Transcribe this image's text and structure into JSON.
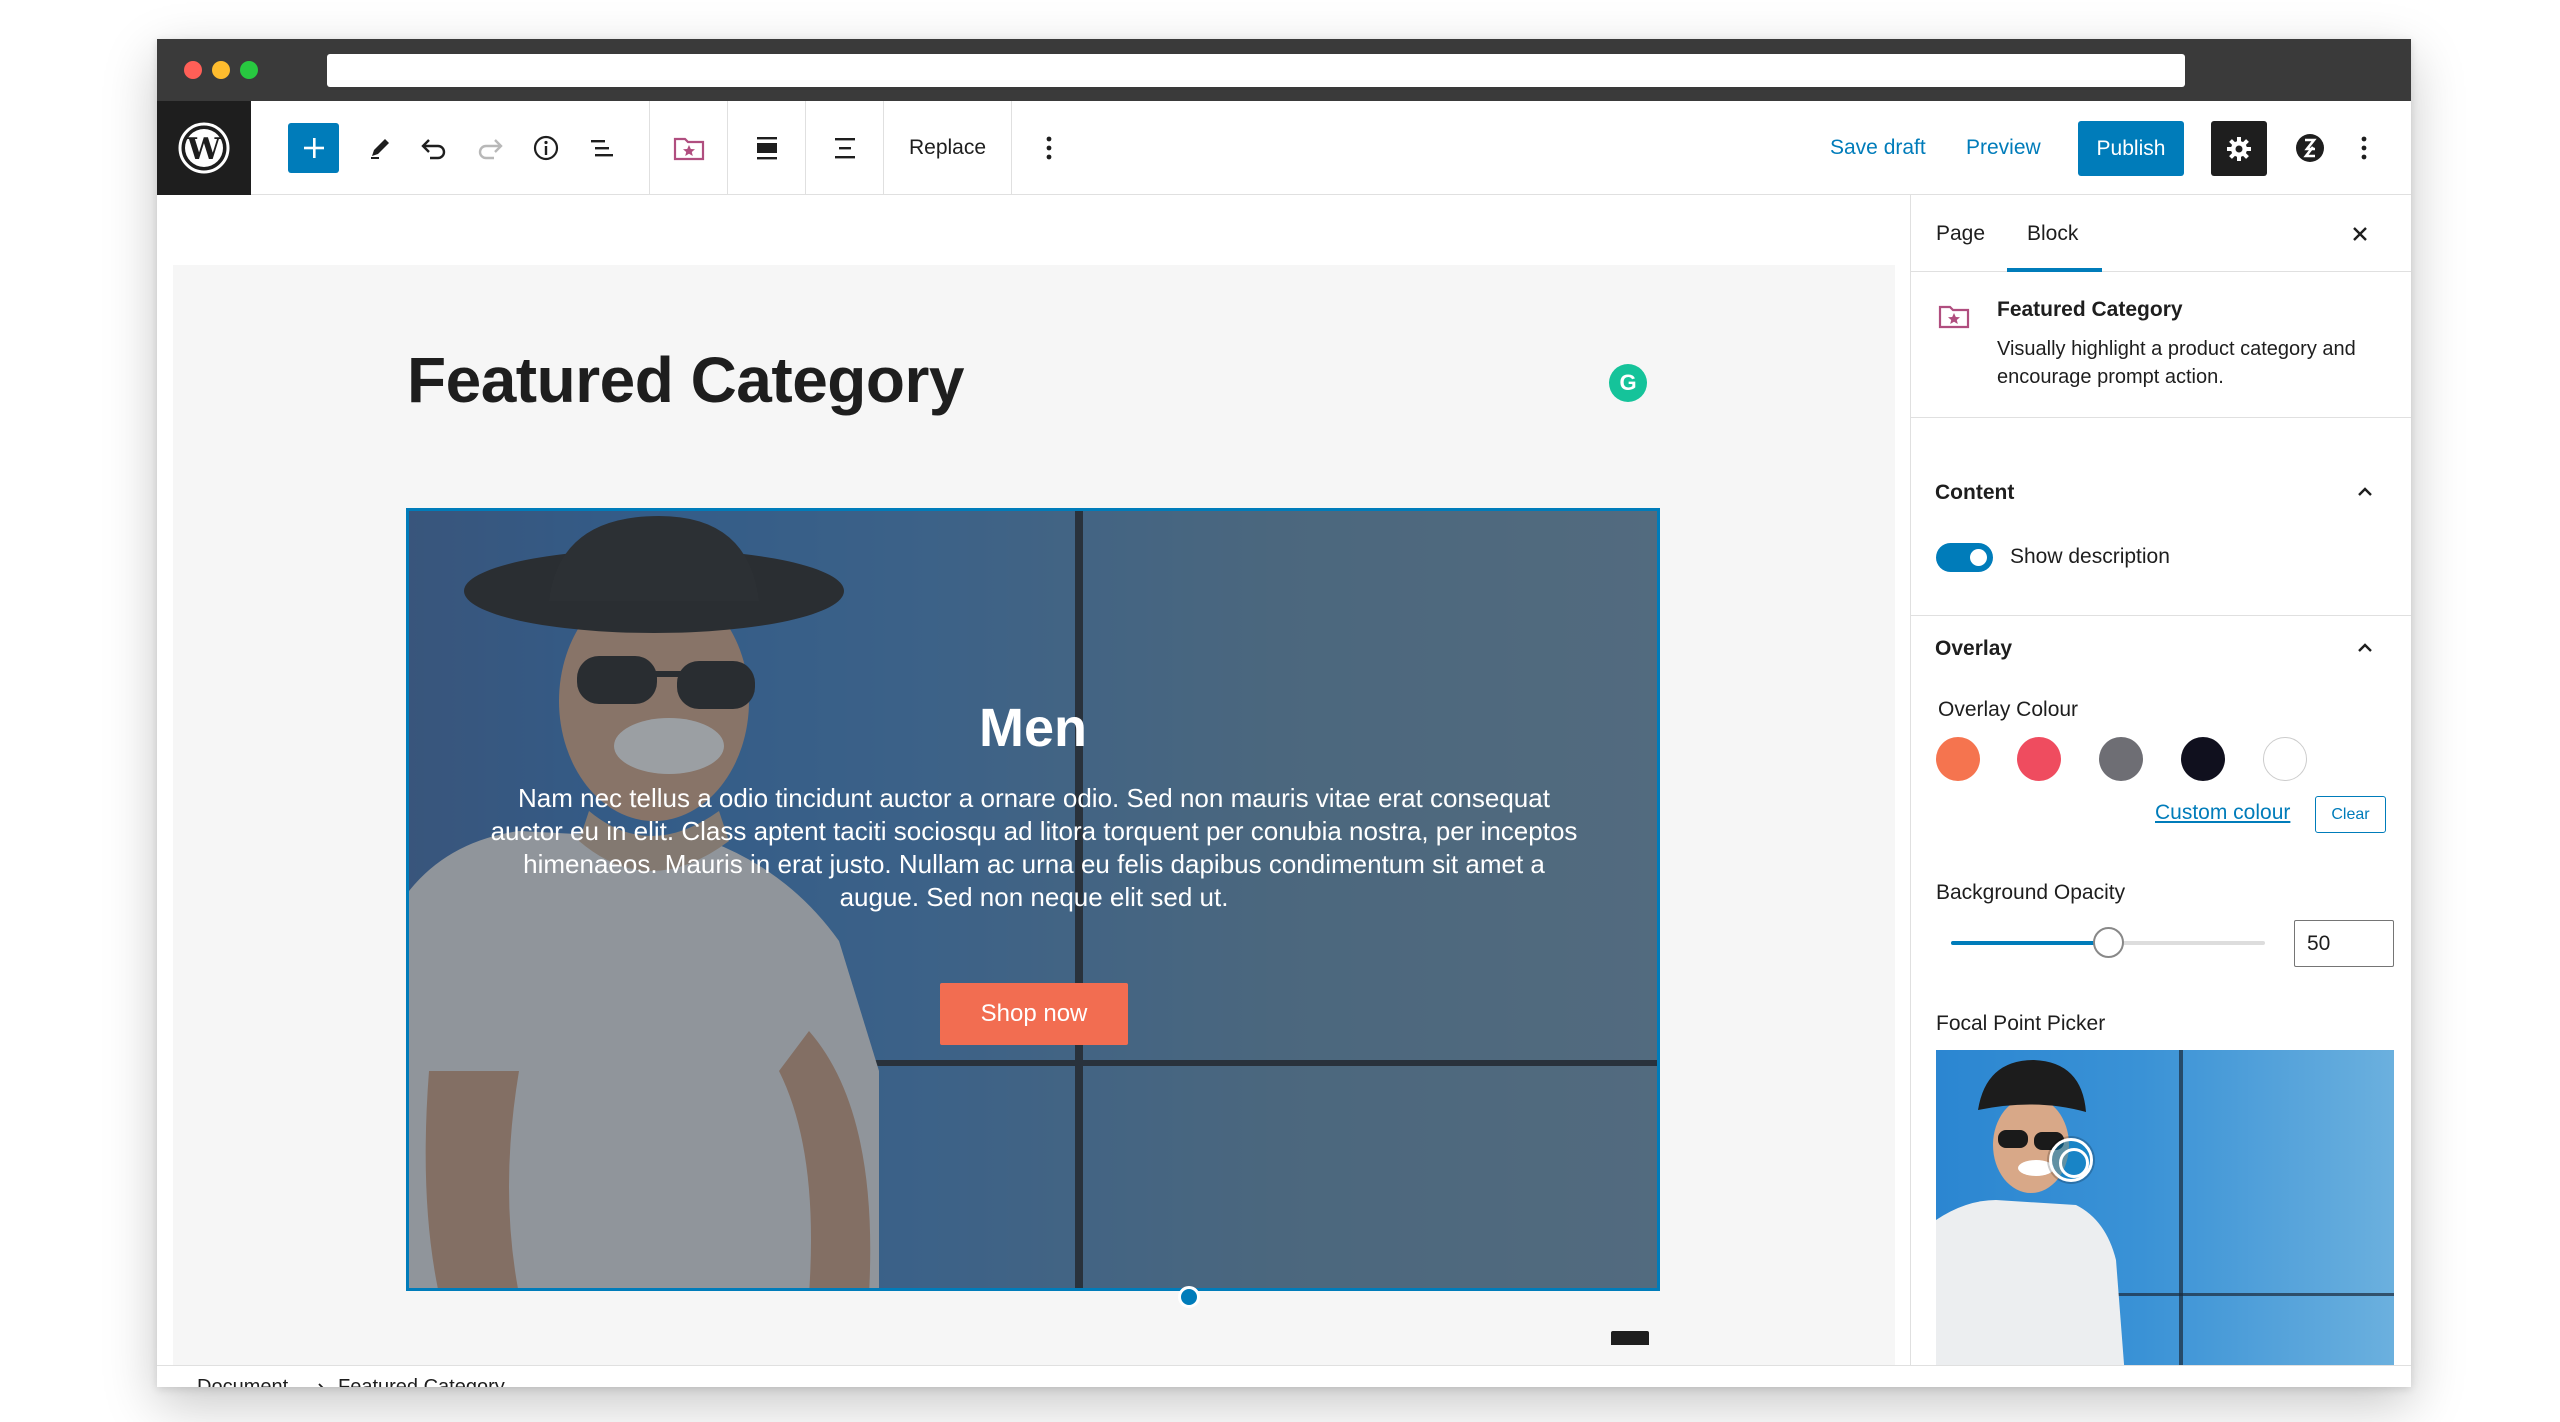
{
  "toolbar": {
    "replace_label": "Replace",
    "save_draft_label": "Save draft",
    "preview_label": "Preview",
    "publish_label": "Publish"
  },
  "editor": {
    "page_title": "Featured Category",
    "grammarly_badge": "G",
    "featured": {
      "title": "Men",
      "description": "Nam nec tellus a odio tincidunt auctor a ornare odio. Sed non mauris vitae erat consequat auctor eu in elit. Class aptent taciti sociosqu ad litora torquent per conubia nostra, per inceptos himenaeos. Mauris in erat justo. Nullam ac urna eu felis dapibus condimentum sit amet a augue. Sed non neque elit sed ut.",
      "button_label": "Shop now"
    }
  },
  "sidebar": {
    "tabs": [
      {
        "label": "Page"
      },
      {
        "label": "Block"
      }
    ],
    "block_card": {
      "title": "Featured Category",
      "description": "Visually highlight a product category and encourage prompt action."
    },
    "content_panel": {
      "title": "Content",
      "toggle_label": "Show description",
      "toggle_on": true
    },
    "overlay_panel": {
      "title": "Overlay",
      "colour_label": "Overlay Colour",
      "swatches": [
        "#f5744f",
        "#ef4c5f",
        "#6e6e74",
        "#10101e",
        "#ffffff"
      ],
      "custom_colour_label": "Custom colour",
      "clear_label": "Clear",
      "opacity_label": "Background Opacity",
      "opacity_value": "50",
      "opacity_fraction": 0.5,
      "focal_label": "Focal Point Picker"
    }
  },
  "breadcrumb": {
    "items": [
      "Document",
      "Featured Category"
    ]
  },
  "colors": {
    "accent": "#007cba",
    "dark": "#1e1e1e",
    "shop_button": "#f26d51"
  }
}
